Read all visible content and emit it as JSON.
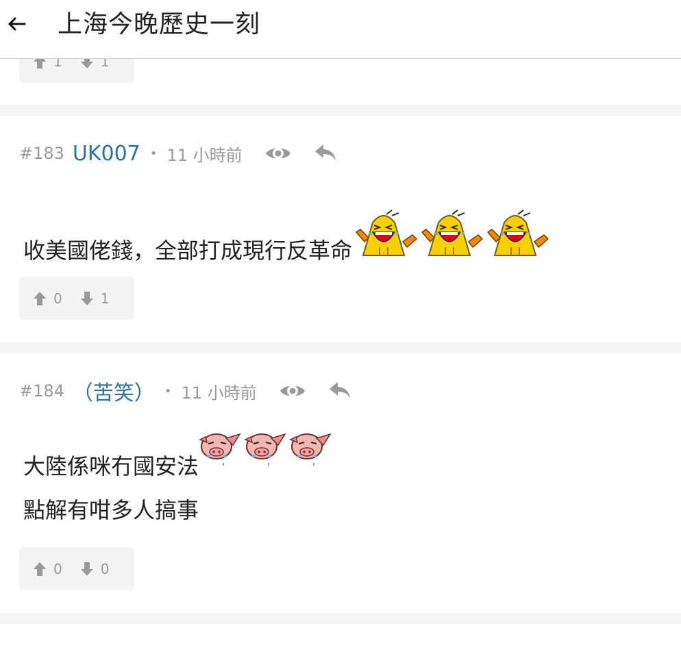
{
  "header": {
    "title": "上海今晚歷史一刻",
    "back_icon": "arrow-left-icon"
  },
  "previous_post": {
    "upvotes": "1",
    "downvotes": "1"
  },
  "posts": [
    {
      "number": "#183",
      "username": "UK007",
      "separator": "•",
      "time": "11 小時前",
      "lines": [
        "收美國佬錢，全部打成現行反革命"
      ],
      "emoji": "laughing-crying-emoji",
      "upvotes": "0",
      "downvotes": "1"
    },
    {
      "number": "#184",
      "username": "（苦笑）",
      "separator": "•",
      "time": "11 小時前",
      "lines": [
        "大陸係咪冇國安法",
        "點解有咁多人搞事"
      ],
      "emoji": "pig-face-emoji",
      "upvotes": "0",
      "downvotes": "0"
    }
  ],
  "colors": {
    "username": "#2a73a6",
    "meta": "#9a9a9a",
    "vote_bg": "#f3f3f3",
    "separator_bg": "#f4f4f4"
  }
}
